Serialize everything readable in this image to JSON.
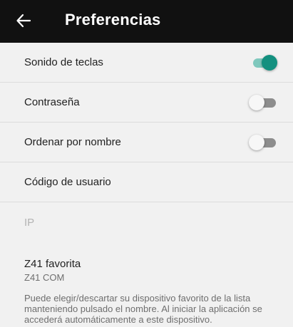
{
  "header": {
    "title": "Preferencias"
  },
  "settings": [
    {
      "label": "Sonido de teclas",
      "toggle": true,
      "on": true
    },
    {
      "label": "Contraseña",
      "toggle": true,
      "on": false
    },
    {
      "label": "Ordenar por nombre",
      "toggle": true,
      "on": false
    },
    {
      "label": "Código de usuario"
    },
    {
      "label": "IP",
      "disabled": true
    }
  ],
  "favorite": {
    "title": "Z41 favorita",
    "value": "Z41 COM",
    "description": "Puede elegir/descartar su dispositivo favorito de la lista manteniendo pulsado el nombre. Al iniciar la aplicación se accederá automáticamente a este dispositivo."
  },
  "colors": {
    "accent": "#13907f",
    "accent_track": "#7fc8bd",
    "appbar": "#111111"
  }
}
